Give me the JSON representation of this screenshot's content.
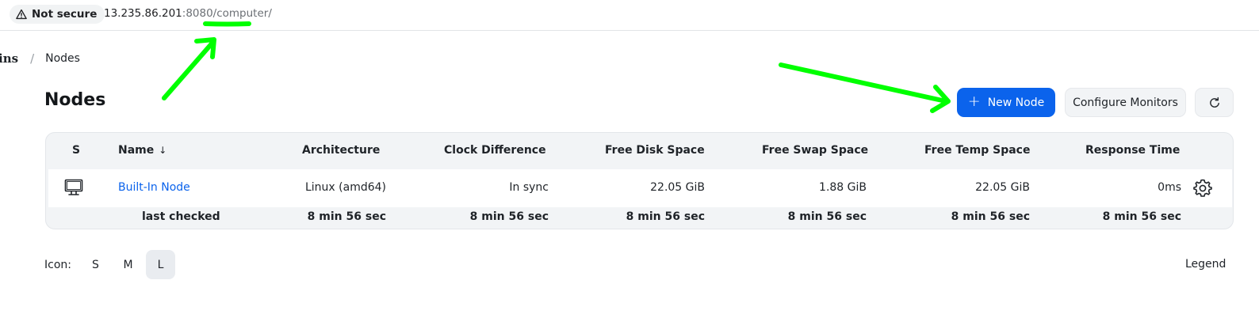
{
  "browser": {
    "security_label": "Not secure",
    "url_host": "13.235.86.201",
    "url_rest": ":8080/computer/"
  },
  "breadcrumb": {
    "root": "ins",
    "separator": "/",
    "current": "Nodes"
  },
  "header": {
    "title": "Nodes",
    "new_node_label": "New Node",
    "configure_monitors_label": "Configure Monitors"
  },
  "table": {
    "columns": {
      "status": "S",
      "name": "Name",
      "name_sort": "↓",
      "architecture": "Architecture",
      "clock_difference": "Clock Difference",
      "free_disk_space": "Free Disk Space",
      "free_swap_space": "Free Swap Space",
      "free_temp_space": "Free Temp Space",
      "response_time": "Response Time"
    },
    "rows": [
      {
        "name": "Built-In Node",
        "architecture": "Linux (amd64)",
        "clock_difference": "In sync",
        "free_disk_space": "22.05 GiB",
        "free_swap_space": "1.88 GiB",
        "free_temp_space": "22.05 GiB",
        "response_time": "0ms"
      }
    ],
    "footer": {
      "label": "last checked",
      "architecture": "8 min 56 sec",
      "clock_difference": "8 min 56 sec",
      "free_disk_space": "8 min 56 sec",
      "free_swap_space": "8 min 56 sec",
      "free_temp_space": "8 min 56 sec",
      "response_time": "8 min 56 sec"
    }
  },
  "icon_size": {
    "label": "Icon:",
    "options": [
      "S",
      "M",
      "L"
    ],
    "selected": "L"
  },
  "legend_label": "Legend",
  "colors": {
    "accent": "#0b63ec",
    "annotation": "#00ff00"
  },
  "icons": [
    "warning-icon",
    "computer-icon",
    "gear-icon",
    "refresh-icon",
    "plus-icon"
  ]
}
